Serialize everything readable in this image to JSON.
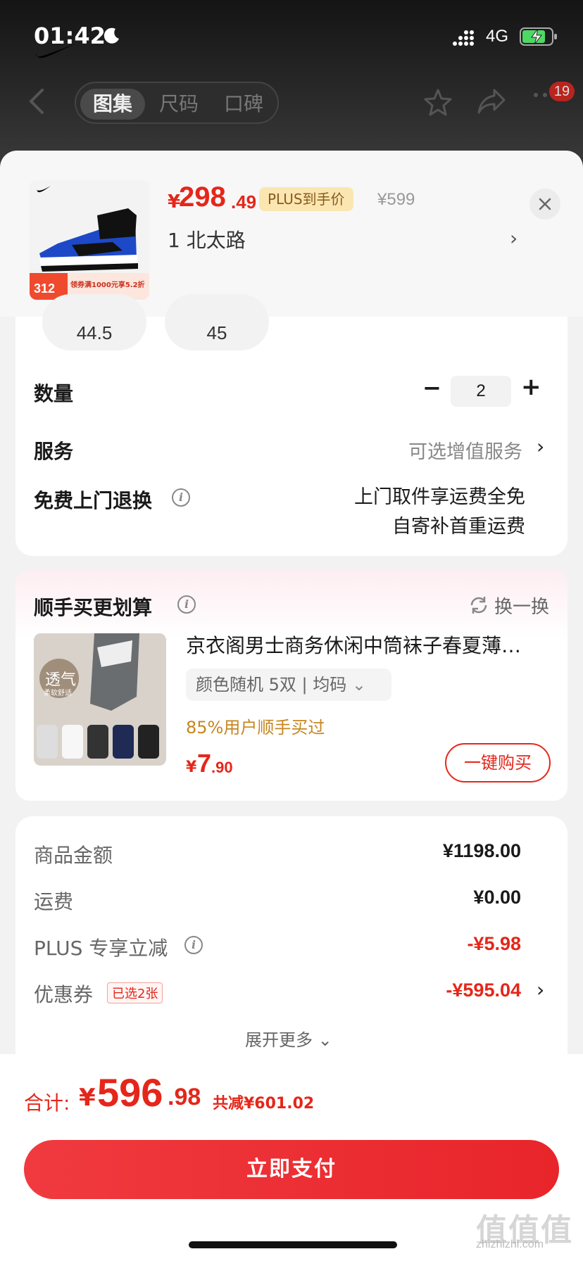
{
  "status_bar": {
    "time": "01:42",
    "network": "4G"
  },
  "nav": {
    "tabs": [
      "图集",
      "尺码",
      "口碑"
    ],
    "active_tab": 0,
    "more_badge": "19"
  },
  "product": {
    "price_symbol": "¥",
    "price_int": "298",
    "price_dec": ".49",
    "plus_tag": "PLUS到手价",
    "original_price": "¥599",
    "selection": "1  北太路",
    "thumb_badge_num": "312",
    "thumb_badge_text": "领券满1000元享5.2折"
  },
  "sizes": [
    "44.5",
    "45"
  ],
  "quantity": {
    "label": "数量",
    "value": "2",
    "minus": "−",
    "plus": "+"
  },
  "service": {
    "label": "服务",
    "value": "可选增值服务"
  },
  "free_return": {
    "label": "免费上门退换",
    "line1": "上门取件享运费全免",
    "line2": "自寄补首重运费"
  },
  "addon": {
    "title": "顺手买更划算",
    "refresh": "换一换",
    "item_title": "京衣阁男士商务休闲中筒袜子春夏薄…",
    "spec": "颜色随机 5双  |  均码",
    "stat": "85%用户顺手买过",
    "price_symbol": "¥",
    "price_int": "7",
    "price_dec": ".90",
    "buy_label": "一键购买",
    "img_text_1": "透气",
    "img_text_2": "柔软舒适"
  },
  "summary": {
    "rows": [
      {
        "label": "商品金额",
        "value": "¥1198.00"
      },
      {
        "label": "运费",
        "value": "¥0.00"
      },
      {
        "label": "PLUS 专享立减",
        "value": "-¥5.98"
      },
      {
        "label": "优惠券",
        "value": "-¥595.04",
        "tag": "已选2张"
      }
    ],
    "expand": "展开更多"
  },
  "footer": {
    "total_label": "合计:",
    "total_symbol": "¥",
    "total_int": "596",
    "total_dec": ".98",
    "saved": "共减¥601.02",
    "pay_label": "立即支付"
  },
  "watermark": {
    "main": "值值值",
    "sub": "zhizhizhi.com"
  },
  "colors": {
    "accent": "#e5261a",
    "plus_tag_bg": "#fbe6b2"
  }
}
